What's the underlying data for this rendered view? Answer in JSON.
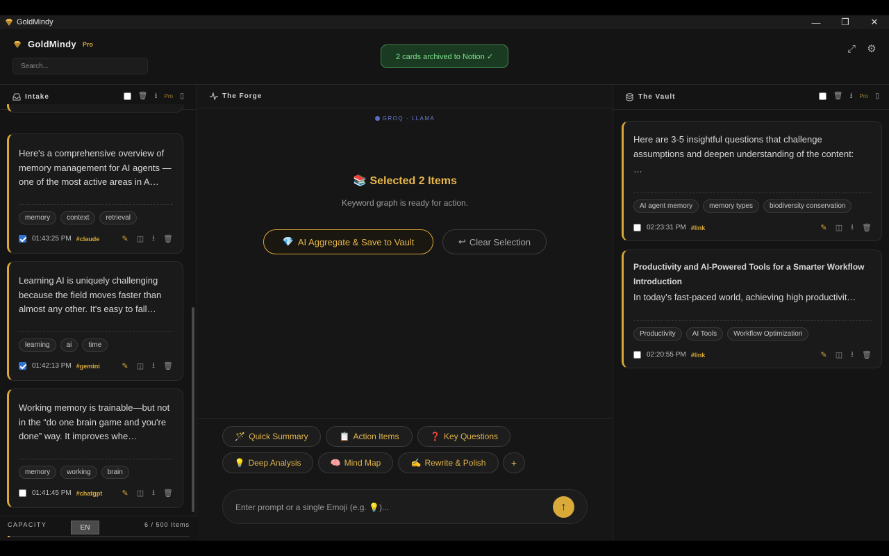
{
  "window": {
    "title": "GoldMindy",
    "controls": {
      "minimize": "—",
      "restore": "❐",
      "close": "✕"
    }
  },
  "header": {
    "brand": "GoldMindy",
    "badge": "Pro",
    "search_placeholder": "Search...",
    "toast": "2 cards archived to Notion ✓"
  },
  "intake": {
    "title": "Intake",
    "pro": "Pro",
    "cards": [
      {
        "text": "Here's a comprehensive overview of memory management for AI agents — one of the most active areas in A…",
        "tags": [
          "memory",
          "context",
          "retrieval"
        ],
        "checked": true,
        "time": "01:43:25 PM",
        "source": "#claude"
      },
      {
        "text": "Learning AI is uniquely challenging because the field moves faster than almost any other. It's easy to fall…",
        "tags": [
          "learning",
          "ai",
          "time"
        ],
        "checked": true,
        "time": "01:42:13 PM",
        "source": "#gemini"
      },
      {
        "text": "Working memory is trainable—but not in the “do one brain game and you're done” way. It improves whe…",
        "tags": [
          "memory",
          "working",
          "brain"
        ],
        "checked": false,
        "time": "01:41:45 PM",
        "source": "#chatgpt"
      }
    ],
    "capacity": {
      "label": "CAPACITY",
      "lang": "EN",
      "count": "6 / 500 Items",
      "used": 6,
      "max": 500
    }
  },
  "forge": {
    "title": "The Forge",
    "model": "GROQ · LLAMA",
    "selected_title": "Selected 2 Items",
    "selected_sub": "Keyword graph is ready for action.",
    "aggregate_btn": "AI Aggregate & Save to Vault",
    "clear_btn": "Clear Selection",
    "chips": [
      {
        "emoji": "🪄",
        "label": "Quick Summary"
      },
      {
        "emoji": "📋",
        "label": "Action Items"
      },
      {
        "emoji": "❓",
        "label": "Key Questions"
      },
      {
        "emoji": "💡",
        "label": "Deep Analysis"
      },
      {
        "emoji": "🧠",
        "label": "Mind Map"
      },
      {
        "emoji": "✍️",
        "label": "Rewrite & Polish"
      }
    ],
    "add_chip": "+",
    "prompt_placeholder": "Enter prompt or a single Emoji (e.g. 💡)..."
  },
  "vault": {
    "title": "The Vault",
    "pro": "Pro",
    "cards": [
      {
        "heading": "",
        "text": "Here are 3-5 insightful questions that challenge assumptions and deepen understanding of the content:",
        "more": "…",
        "tags": [
          "AI agent memory",
          "memory types",
          "biodiversity conservation"
        ],
        "checked": false,
        "time": "02:23:31 PM",
        "source": "#link"
      },
      {
        "heading": "Productivity and AI-Powered Tools for a Smarter Workflow Introduction",
        "text": "In today's fast-paced world, achieving high productivit…",
        "tags": [
          "Productivity",
          "AI Tools",
          "Workflow Optimization"
        ],
        "checked": false,
        "time": "02:20:55 PM",
        "source": "#link"
      }
    ]
  },
  "colors": {
    "accent": "#d9a93a",
    "toast_bg": "#1b3a22",
    "toast_text": "#7fe08f",
    "bg": "#141414"
  },
  "icons": {
    "edit": "pencil-icon",
    "split": "panel-icon",
    "download": "download-icon",
    "delete": "trash-icon"
  }
}
